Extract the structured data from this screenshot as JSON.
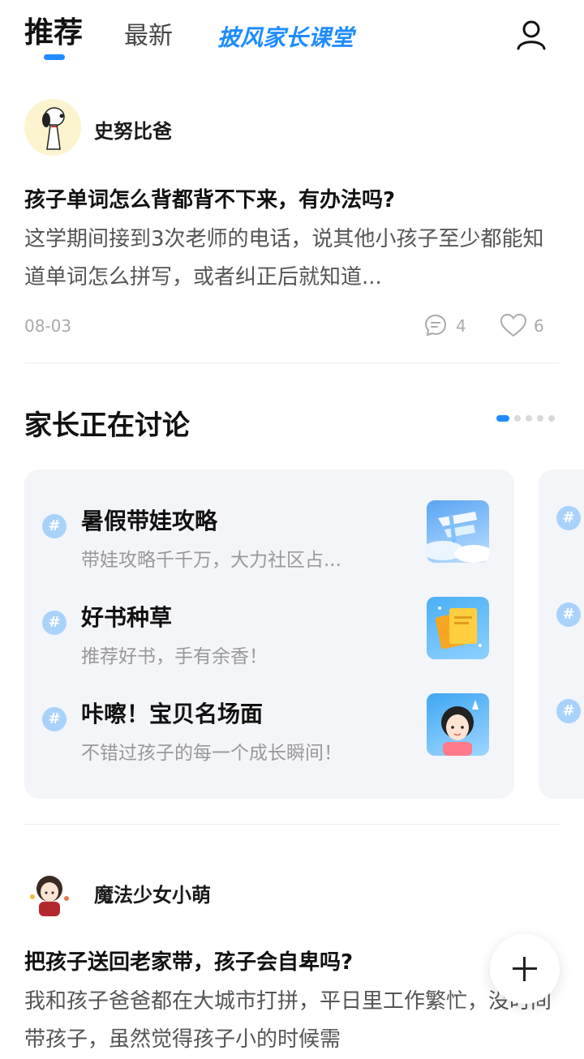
{
  "header": {
    "tabs": [
      {
        "label": "推荐"
      },
      {
        "label": "最新"
      },
      {
        "label": "披风家长课堂"
      }
    ]
  },
  "posts": [
    {
      "author": "史努比爸",
      "title": "孩子单词怎么背都背不下来，有办法吗?",
      "body": "这学期间接到3次老师的电话，说其他小孩子至少都能知道单词怎么拼写，或者纠正后就知道...",
      "date": "08-03",
      "comments": "4",
      "likes": "6"
    },
    {
      "author": "魔法少女小萌",
      "title": "把孩子送回老家带，孩子会自卑吗?",
      "body": "我和孩子爸爸都在大城市打拼，平日里工作繁忙，没时间带孩子，虽然觉得孩子小的时候需"
    }
  ],
  "discussion": {
    "title": "家长正在讨论",
    "hash_symbol": "#",
    "topics": [
      {
        "title": "暑假带娃攻略",
        "desc": "带娃攻略千千万，大力社区占..."
      },
      {
        "title": "好书种草",
        "desc": "推荐好书，手有余香！"
      },
      {
        "title": "咔嚓！宝贝名场面",
        "desc": "不错过孩子的每一个成长瞬间！"
      }
    ]
  },
  "colors": {
    "accent": "#1e8cff",
    "panel": "#f4f5f8"
  }
}
